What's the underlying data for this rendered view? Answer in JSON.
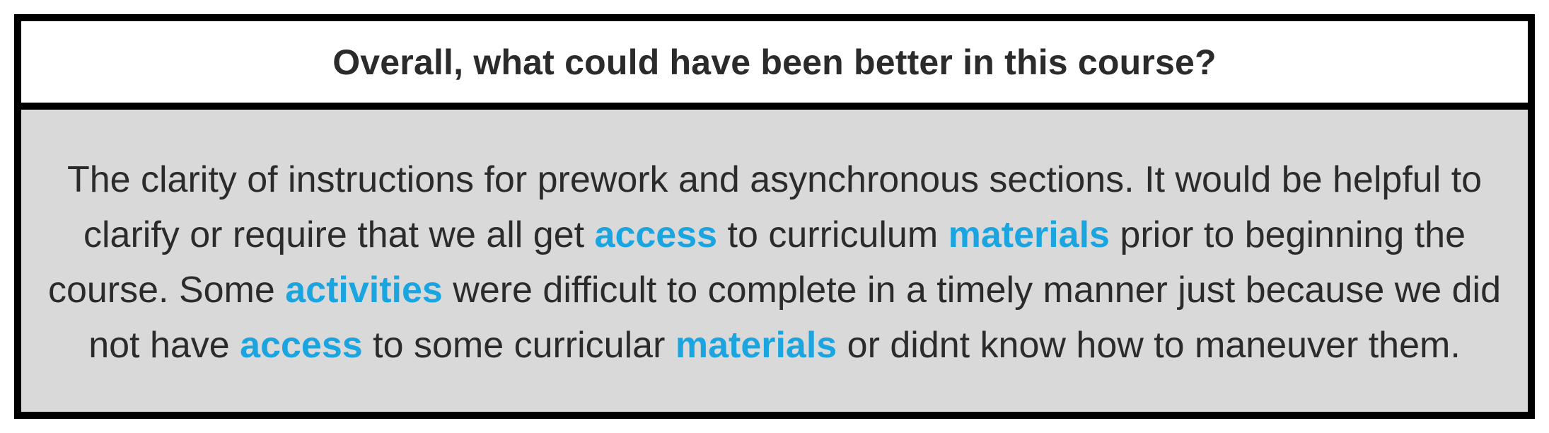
{
  "question": "Overall, what could have been better in this course?",
  "response": {
    "segments": [
      {
        "text": "The clarity of instructions for prework and asynchronous sections. It would be helpful to clarify or require that we all get ",
        "highlight": false
      },
      {
        "text": "access",
        "highlight": true
      },
      {
        "text": " to curriculum ",
        "highlight": false
      },
      {
        "text": "materials",
        "highlight": true
      },
      {
        "text": " prior to beginning the course. Some ",
        "highlight": false
      },
      {
        "text": "activities",
        "highlight": true
      },
      {
        "text": " were difficult to complete in a timely manner just because we did not have ",
        "highlight": false
      },
      {
        "text": "access",
        "highlight": true
      },
      {
        "text": " to some curricular ",
        "highlight": false
      },
      {
        "text": "materials",
        "highlight": true
      },
      {
        "text": " or didnt know how to maneuver them.",
        "highlight": false
      }
    ]
  },
  "colors": {
    "border": "#000000",
    "header_background": "#ffffff",
    "body_background": "#d9d9d9",
    "text": "#2b2b2b",
    "highlight": "#1aa5e0"
  }
}
